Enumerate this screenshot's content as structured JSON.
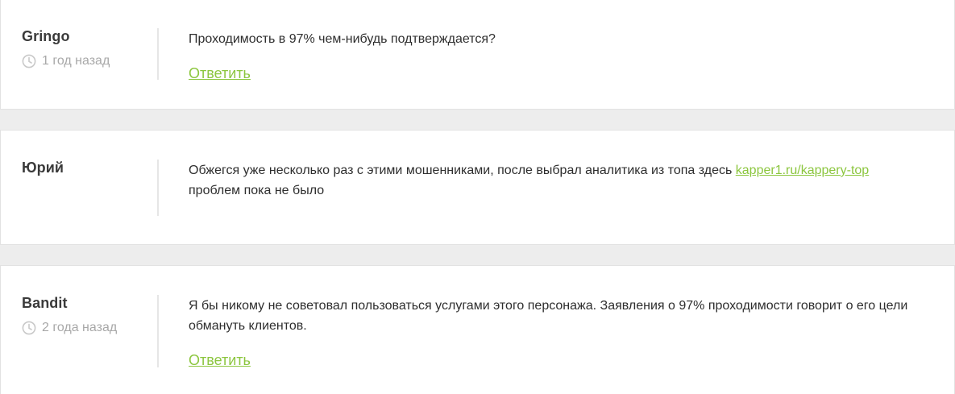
{
  "comments": [
    {
      "author": "Gringo",
      "time": "1 год назад",
      "text": "Проходимость в 97% чем-нибудь подтверждается?",
      "reply_label": "Ответить"
    },
    {
      "author": "Юрий",
      "text_before_link": "Обжегся уже несколько раз с этими мошенниками, после выбрал аналитика из топа здесь ",
      "link_text": "kapper1.ru/kappery-top",
      "text_after_link": "проблем пока не было"
    },
    {
      "author": "Bandit",
      "time": "2 года назад",
      "text": "Я бы никому не советовал пользоваться услугами этого персонажа. Заявления о 97% проходимости говорит о его цели обмануть клиентов.",
      "reply_label": "Ответить"
    }
  ],
  "icons": {
    "time": "clock-icon"
  },
  "colors": {
    "accent": "#8cc63f",
    "muted": "#a8a8a8",
    "background": "#ededed"
  }
}
